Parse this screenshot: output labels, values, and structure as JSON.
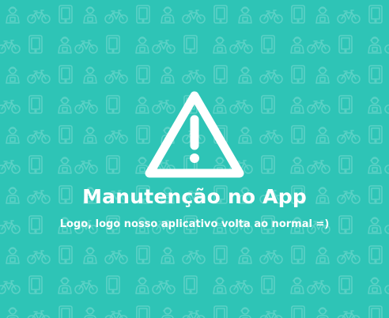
{
  "screen": {
    "background_color": "#2ec4b6",
    "pattern_color": "#ffffff",
    "pattern_icons": [
      "person-icon",
      "bicycle-icon",
      "tablet-icon"
    ]
  },
  "message": {
    "icon": "warning-triangle-icon",
    "title": "Manutenção no App",
    "subtitle": "Logo, logo nosso aplicativo volta ao normal =)"
  }
}
